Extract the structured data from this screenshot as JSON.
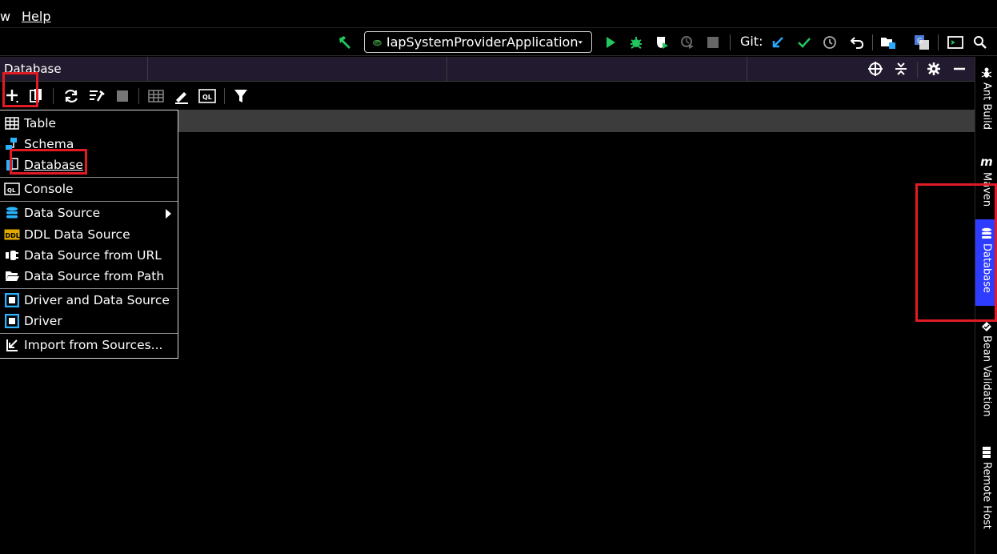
{
  "menubar": {
    "items": [
      {
        "label": "w"
      },
      {
        "label": "Help"
      }
    ]
  },
  "toolbar": {
    "run_config": "IapSystemProviderApplication",
    "git_label": "Git:"
  },
  "panel": {
    "title": "Database"
  },
  "new_menu": {
    "items": [
      {
        "label": "Table",
        "icon": "table-icon"
      },
      {
        "label": "Schema",
        "icon": "schema-icon"
      },
      {
        "label": "Database",
        "icon": "database-icon"
      },
      {
        "label": "Console",
        "icon": "console-icon"
      },
      {
        "label": "Data Source",
        "icon": "datasource-icon",
        "has_submenu": true
      },
      {
        "label": "DDL Data Source",
        "icon": "ddl-icon"
      },
      {
        "label": "Data Source from URL",
        "icon": "url-icon"
      },
      {
        "label": "Data Source from Path",
        "icon": "folder-icon"
      },
      {
        "label": "Driver and Data Source",
        "icon": "driver-icon"
      },
      {
        "label": "Driver",
        "icon": "driver-icon"
      },
      {
        "label": "Import from Sources...",
        "icon": "import-icon"
      }
    ]
  },
  "right_sidebar": {
    "tabs": [
      {
        "label": "Ant Build",
        "icon": "ant-icon"
      },
      {
        "label": "Maven",
        "icon": "maven-icon"
      },
      {
        "label": "Database",
        "icon": "database-icon",
        "active": true
      },
      {
        "label": "Bean Validation",
        "icon": "bean-icon"
      },
      {
        "label": "Remote Host",
        "icon": "server-icon"
      }
    ]
  },
  "colors": {
    "panel_header_bg": "#221a2e",
    "active_tab": "#2d3cff",
    "highlight": "#e01b24",
    "run_green": "#22c55e"
  }
}
